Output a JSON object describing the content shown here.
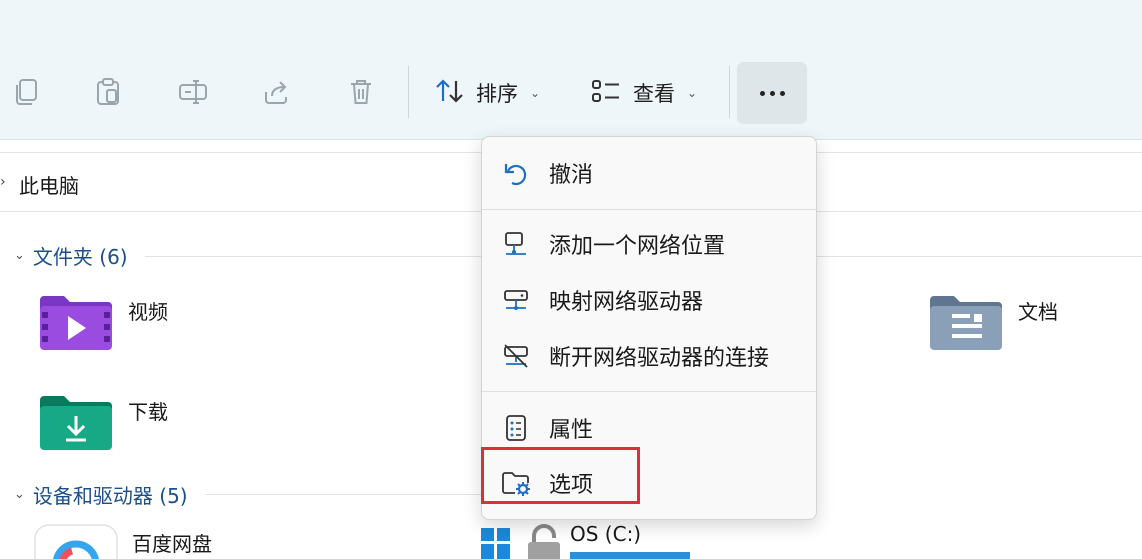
{
  "toolbar": {
    "sort_label": "排序",
    "view_label": "查看",
    "more_label": "更多"
  },
  "address": {
    "path": "此电脑"
  },
  "sections": {
    "folders_title": "文件夹 (6)",
    "devices_title": "设备和驱动器 (5)"
  },
  "folders": [
    {
      "label": "视频",
      "icon": "video-folder-icon",
      "color": "#8b3fd6"
    },
    {
      "label": "下载",
      "icon": "download-folder-icon",
      "color": "#0f9b78"
    },
    {
      "label": "文档",
      "icon": "documents-folder-icon",
      "color": "#7b8fa6"
    }
  ],
  "devices": [
    {
      "label": "百度网盘"
    },
    {
      "label": "OS (C:)"
    }
  ],
  "menu": {
    "undo": "撤消",
    "add_network_location": "添加一个网络位置",
    "map_network_drive": "映射网络驱动器",
    "disconnect_network_drive": "断开网络驱动器的连接",
    "properties": "属性",
    "options": "选项"
  },
  "colors": {
    "accent": "#1c4f8a",
    "highlight": "#d8313a",
    "toolbar_bg": "#eff6fa",
    "icon_blue": "#1d6fc4"
  }
}
